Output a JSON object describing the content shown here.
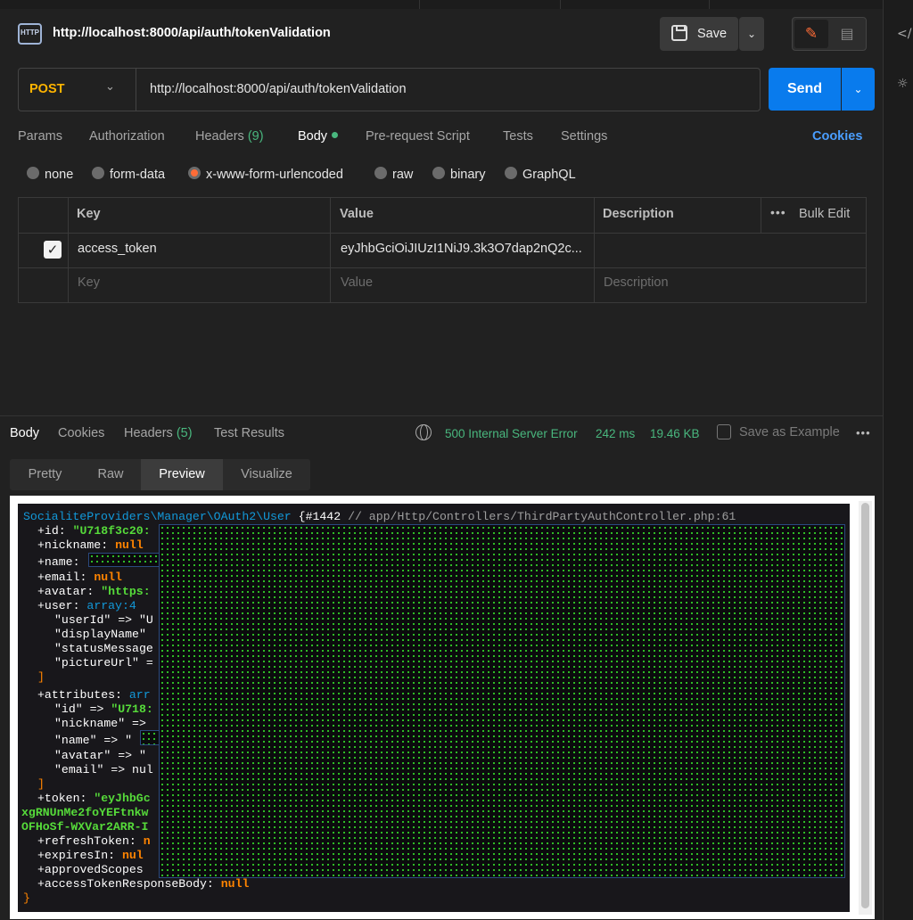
{
  "header": {
    "icon_text": "HTTP",
    "title": "http://localhost:8000/api/auth/tokenValidation",
    "save_label": "Save",
    "chevron": "⌄"
  },
  "request": {
    "method": "POST",
    "url": "http://localhost:8000/api/auth/tokenValidation",
    "send_label": "Send"
  },
  "request_tabs": [
    {
      "label": "Params"
    },
    {
      "label": "Authorization"
    },
    {
      "label": "Headers",
      "count": "(9)"
    },
    {
      "label": "Body",
      "active": true
    },
    {
      "label": "Pre-request Script"
    },
    {
      "label": "Tests"
    },
    {
      "label": "Settings"
    }
  ],
  "cookies_label": "Cookies",
  "body_types": [
    "none",
    "form-data",
    "x-www-form-urlencoded",
    "raw",
    "binary",
    "GraphQL"
  ],
  "body_type_selected": "x-www-form-urlencoded",
  "table": {
    "headers": {
      "key": "Key",
      "value": "Value",
      "description": "Description",
      "bulk_edit": "Bulk Edit"
    },
    "rows": [
      {
        "checked": true,
        "key": "access_token",
        "value": "eyJhbGciOiJIUzI1NiJ9.3k3O7dap2nQ2c...",
        "description": ""
      }
    ],
    "placeholder": {
      "key": "Key",
      "value": "Value",
      "description": "Description"
    }
  },
  "response": {
    "tabs": [
      {
        "label": "Body",
        "active": true
      },
      {
        "label": "Cookies"
      },
      {
        "label": "Headers",
        "count": "(5)"
      },
      {
        "label": "Test Results"
      }
    ],
    "status": "500 Internal Server Error",
    "time": "242 ms",
    "size": "19.46 KB",
    "save_example": "Save as Example",
    "view_tabs": [
      "Pretty",
      "Raw",
      "Preview",
      "Visualize"
    ],
    "view_selected": "Preview"
  },
  "dump": {
    "class_name": "SocialiteProviders\\Manager\\OAuth2\\User",
    "object_id": "{#1442",
    "comment": "// app/Http/Controllers/ThirdPartyAuthController.php:61",
    "lines": {
      "id": "\"U718f3c20:",
      "nickname": "null",
      "email": "null",
      "avatar": "\"https:",
      "user_type": "array:4",
      "user_userId": "\"userId\" => \"U",
      "user_displayName": "\"displayName\"",
      "user_statusMessage": "\"statusMessage",
      "user_pictureUrl": "\"pictureUrl\" =",
      "attributes_type": "arr",
      "attr_id": "\"U718:",
      "attr_nickname": "\"nickname\" =>",
      "attr_name": "\"name\" => \"",
      "attr_avatar": "\"avatar\" => \"",
      "attr_email": "\"email\" => nul",
      "token_val": "\"eyJhbGc",
      "token_line2": "xgRNUnMe2foYEFtnkw",
      "token_line3": "OFHoSf-WXVar2ARR-I",
      "refreshToken_val": "n",
      "expiresIn_val": "nul",
      "accessTokenResponseBody_val": "null"
    }
  },
  "colors": {
    "accent": "#ff6c37",
    "send": "#097bed",
    "success": "#49b77e",
    "method": "#ffb400",
    "link": "#4a9eff"
  }
}
